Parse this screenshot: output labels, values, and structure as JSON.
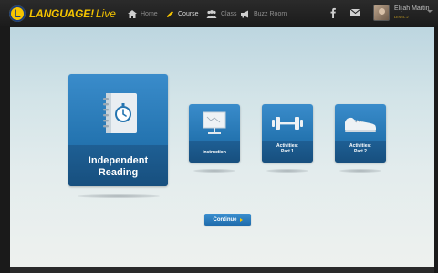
{
  "app": {
    "logo_letter": "L",
    "brand_bold": "LANGUAGE!",
    "brand_light": "Live"
  },
  "nav": {
    "items": [
      {
        "label": "Home",
        "icon": "home-icon"
      },
      {
        "label": "Course",
        "icon": "pencil-icon"
      },
      {
        "label": "Class",
        "icon": "people-icon"
      },
      {
        "label": "Buzz Room",
        "icon": "megaphone-icon"
      }
    ],
    "active": "Course"
  },
  "user": {
    "name": "Elijah Martin",
    "level": "LEVEL 2"
  },
  "tiles": {
    "main": {
      "label_line1": "Independent",
      "label_line2": "Reading",
      "icon": "notebook-timer-icon"
    },
    "instruction": {
      "label": "Instruction",
      "icon": "presentation-board-icon"
    },
    "activities1": {
      "label_line1": "Activities:",
      "label_line2": "Part 1",
      "icon": "dumbbell-icon"
    },
    "activities2": {
      "label_line1": "Activities:",
      "label_line2": "Part 2",
      "icon": "sneaker-icon"
    }
  },
  "actions": {
    "continue_label": "Continue"
  },
  "colors": {
    "topbar": "#1c1c1c",
    "brand_yellow": "#f5c400",
    "tile_blue": "#2474b0",
    "tile_dark": "#174f7e",
    "background_top": "#bdd6e0"
  }
}
